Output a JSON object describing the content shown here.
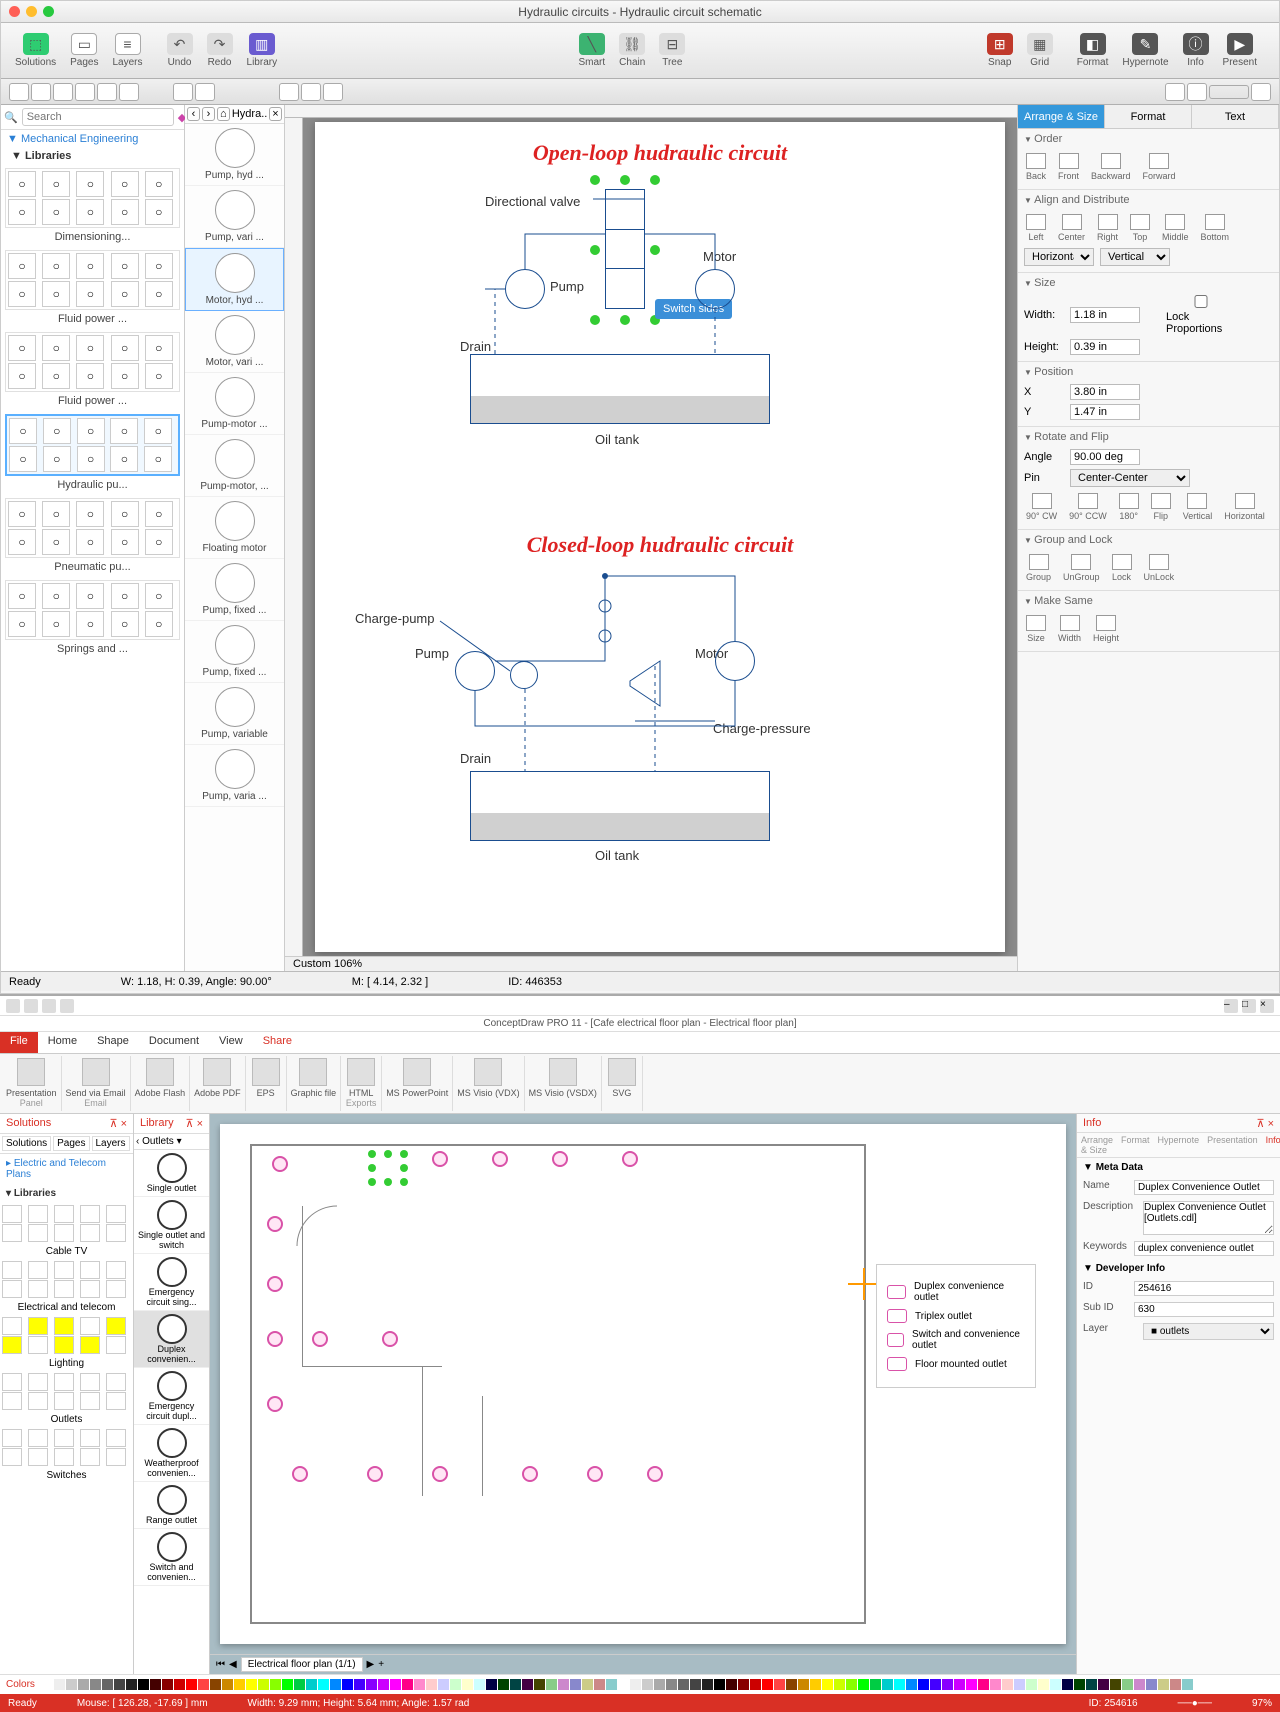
{
  "app1": {
    "title": "Hydraulic circuits - Hydraulic circuit schematic",
    "toolbar": [
      {
        "label": "Solutions"
      },
      {
        "label": "Pages"
      },
      {
        "label": "Layers"
      },
      {
        "label": "Undo"
      },
      {
        "label": "Redo"
      },
      {
        "label": "Library"
      },
      {
        "label": "Smart"
      },
      {
        "label": "Chain"
      },
      {
        "label": "Tree"
      },
      {
        "label": "Snap"
      },
      {
        "label": "Grid"
      },
      {
        "label": "Format"
      },
      {
        "label": "Hypernote"
      },
      {
        "label": "Info"
      },
      {
        "label": "Present"
      }
    ],
    "search_placeholder": "Search",
    "tree_root": "Mechanical Engineering",
    "tree_sub": "Libraries",
    "libs": [
      {
        "name": "Dimensioning..."
      },
      {
        "name": "Fluid power ..."
      },
      {
        "name": "Fluid power ..."
      },
      {
        "name": "Hydraulic pu...",
        "selected": true
      },
      {
        "name": "Pneumatic pu..."
      },
      {
        "name": "Springs and ..."
      }
    ],
    "mid_header": "Hydra...",
    "mid_items": [
      {
        "name": "Pump, hyd ..."
      },
      {
        "name": "Pump, vari ..."
      },
      {
        "name": "Motor, hyd ...",
        "selected": true
      },
      {
        "name": "Motor, vari ..."
      },
      {
        "name": "Pump-motor ..."
      },
      {
        "name": "Pump-motor, ..."
      },
      {
        "name": "Floating motor"
      },
      {
        "name": "Pump, fixed ..."
      },
      {
        "name": "Pump, fixed ..."
      },
      {
        "name": "Pump, variable"
      },
      {
        "name": "Pump, varia ..."
      }
    ],
    "canvas": {
      "title1": "Open-loop hudraulic circuit",
      "title2": "Closed-loop hudraulic circuit",
      "labels": {
        "dirvalve": "Directional valve",
        "pump": "Pump",
        "motor": "Motor",
        "drain": "Drain",
        "oiltank": "Oil tank",
        "chargepump": "Charge-pump",
        "chargepressure": "Charge-pressure"
      },
      "tooltip": "Switch sides",
      "zoom": "Custom 106%"
    },
    "right": {
      "tabs": [
        "Arrange & Size",
        "Format",
        "Text"
      ],
      "order": {
        "hd": "Order",
        "items": [
          "Back",
          "Front",
          "Backward",
          "Forward"
        ]
      },
      "align": {
        "hd": "Align and Distribute",
        "items": [
          "Left",
          "Center",
          "Right",
          "Top",
          "Middle",
          "Bottom"
        ],
        "h": "Horizontal",
        "v": "Vertical"
      },
      "size": {
        "hd": "Size",
        "width": "1.18 in",
        "height": "0.39 in",
        "lock": "Lock Proportions"
      },
      "position": {
        "hd": "Position",
        "x": "3.80 in",
        "y": "1.47 in"
      },
      "rotate": {
        "hd": "Rotate and Flip",
        "angle": "90.00 deg",
        "pin": "Center-Center",
        "items": [
          "90° CW",
          "90° CCW",
          "180°",
          "Flip",
          "Vertical",
          "Horizontal"
        ]
      },
      "group": {
        "hd": "Group and Lock",
        "items": [
          "Group",
          "UnGroup",
          "Lock",
          "UnLock"
        ]
      },
      "make": {
        "hd": "Make Same",
        "items": [
          "Size",
          "Width",
          "Height"
        ]
      }
    },
    "status": {
      "ready": "Ready",
      "dims": "W: 1.18,  H: 0.39,  Angle: 90.00°",
      "mouse": "M: [ 4.14, 2.32 ]",
      "id": "ID: 446353"
    }
  },
  "app2": {
    "title": "ConceptDraw PRO 11 - [Cafe electrical floor plan - Electrical floor plan]",
    "ribbon_tabs": [
      "File",
      "Home",
      "Shape",
      "Document",
      "View",
      "Share"
    ],
    "ribbon_items": [
      {
        "label": "Presentation",
        "sub": "Panel"
      },
      {
        "label": "Send via Email",
        "sub": "Email"
      },
      {
        "label": "Adobe Flash",
        "sub": ""
      },
      {
        "label": "Adobe PDF",
        "sub": ""
      },
      {
        "label": "EPS",
        "sub": ""
      },
      {
        "label": "Graphic file",
        "sub": ""
      },
      {
        "label": "HTML",
        "sub": "Exports"
      },
      {
        "label": "MS PowerPoint",
        "sub": ""
      },
      {
        "label": "MS Visio (VDX)",
        "sub": ""
      },
      {
        "label": "MS Visio (VSDX)",
        "sub": ""
      },
      {
        "label": "SVG",
        "sub": ""
      }
    ],
    "left": {
      "solutions_hdr": "Solutions",
      "library_hdr": "Library",
      "tabs": [
        "Solutions",
        "Pages",
        "Layers"
      ],
      "tree": "Electric and Telecom Plans",
      "tree2": "Libraries",
      "libs": [
        "Cable TV",
        "Electrical and telecom",
        "Lighting",
        "Outlets",
        "Switches"
      ]
    },
    "mid_hdr": "Outlets",
    "mid_items": [
      {
        "name": "Single outlet"
      },
      {
        "name": "Single outlet and switch"
      },
      {
        "name": "Emergency circuit sing..."
      },
      {
        "name": "Duplex convenien...",
        "selected": true
      },
      {
        "name": "Emergency circuit dupl..."
      },
      {
        "name": "Weatherproof convenien..."
      },
      {
        "name": "Range outlet"
      },
      {
        "name": "Switch and convenien..."
      }
    ],
    "legend": {
      "items": [
        "Duplex convenience outlet",
        "Triplex outlet",
        "Switch and convenience outlet",
        "Floor mounted outlet"
      ]
    },
    "right": {
      "hdr": "Info",
      "tabs": [
        "Arrange & Size",
        "Format",
        "Hypernote",
        "Presentation",
        "Info"
      ],
      "meta_hd": "Meta Data",
      "name": "Duplex Convenience Outlet",
      "desc": "Duplex Convenience Outlet\n[Outlets.cdl]",
      "keywords": "duplex convenience outlet",
      "dev_hd": "Developer Info",
      "id": "254616",
      "subid": "630",
      "layer": "outlets"
    },
    "sheet": "Electrical floor plan (1/1)",
    "colors_hdr": "Colors",
    "status": {
      "ready": "Ready",
      "mouse": "Mouse: [ 126.28, -17.69 ] mm",
      "dims": "Width: 9.29 mm;  Height: 5.64 mm;  Angle: 1.57 rad",
      "id": "ID: 254616",
      "zoom": "97%"
    }
  }
}
